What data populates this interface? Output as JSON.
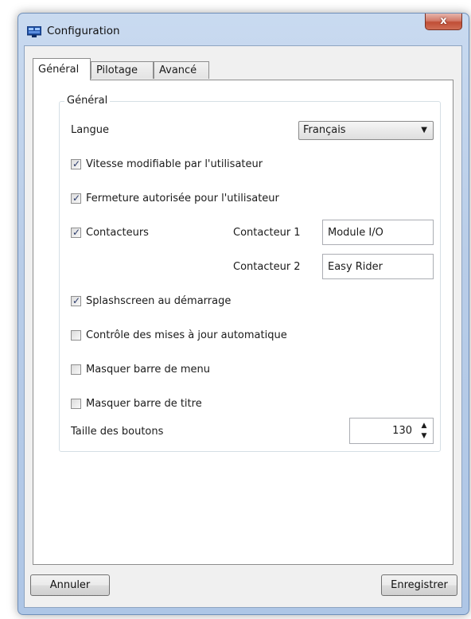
{
  "window": {
    "title": "Configuration",
    "close_glyph": "x",
    "app_icon": "window-app-icon"
  },
  "tabs": [
    {
      "label": "Général",
      "active": true
    },
    {
      "label": "Pilotage",
      "active": false
    },
    {
      "label": "Avancé",
      "active": false
    }
  ],
  "group": {
    "legend": "Général",
    "language": {
      "label": "Langue",
      "value": "Français",
      "arrow": "▼"
    },
    "options": [
      {
        "label": "Vitesse modifiable par l'utilisateur",
        "checked": true
      },
      {
        "label": "Fermeture autorisée pour l'utilisateur",
        "checked": true
      },
      {
        "label": "Contacteurs",
        "checked": true
      },
      {
        "label": "Splashscreen au démarrage",
        "checked": true
      },
      {
        "label": "Contrôle des mises à jour automatique",
        "checked": false
      },
      {
        "label": "Masquer barre de menu",
        "checked": false
      },
      {
        "label": "Masquer barre de titre",
        "checked": false
      }
    ],
    "check_glyph": "✓",
    "contacts": [
      {
        "label": "Contacteur 1",
        "value": "Module I/O"
      },
      {
        "label": "Contacteur 2",
        "value": "Easy Rider"
      }
    ],
    "button_size": {
      "label": "Taille des boutons",
      "value": "130",
      "up": "▲",
      "down": "▼"
    }
  },
  "buttons": {
    "cancel": "Annuler",
    "save": "Enregistrer"
  },
  "colors": {
    "title_bar": "#b9cde8",
    "close_button": "#c04e36",
    "client_background": "#f0f0f0",
    "checkbox_mark": "#2a3a6a"
  }
}
